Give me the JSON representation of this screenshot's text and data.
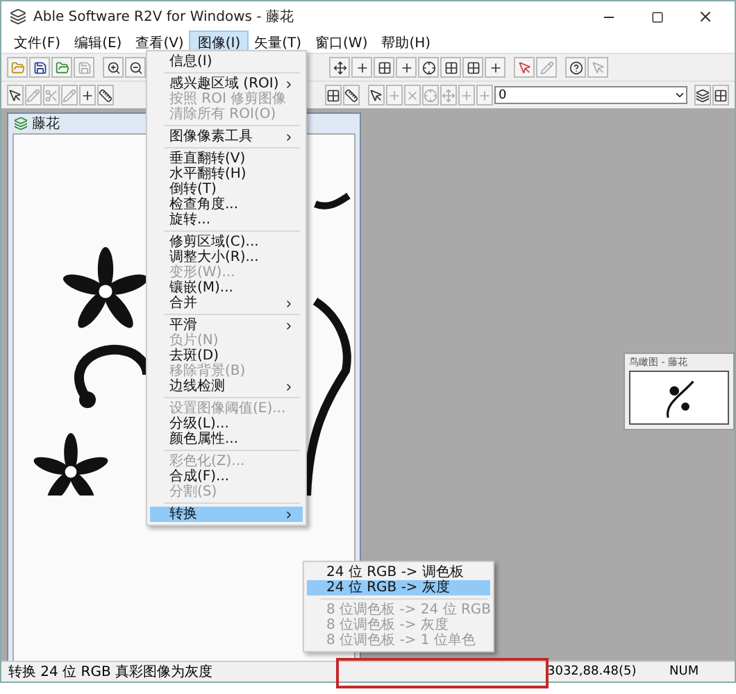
{
  "window": {
    "title": "Able Software R2V for Windows - 藤花"
  },
  "menubar": [
    {
      "label": "文件(F)",
      "selected": false
    },
    {
      "label": "编辑(E)",
      "selected": false
    },
    {
      "label": "查看(V)",
      "selected": false
    },
    {
      "label": "图像(I)",
      "selected": true
    },
    {
      "label": "矢量(T)",
      "selected": false
    },
    {
      "label": "窗口(W)",
      "selected": false
    },
    {
      "label": "帮助(H)",
      "selected": false
    }
  ],
  "toolbar": {
    "layer_field": {
      "value": "0"
    }
  },
  "image_window": {
    "title": "藤花"
  },
  "navigator": {
    "title": "鸟瞰图 - 藤花"
  },
  "menu": [
    {
      "kind": "item",
      "label": "信息(I)",
      "disabled": false,
      "submenu": false,
      "selected": false
    },
    {
      "kind": "separator"
    },
    {
      "kind": "item",
      "label": "感兴趣区域 (ROI)",
      "disabled": false,
      "submenu": true,
      "selected": false
    },
    {
      "kind": "item",
      "label": "按照 ROI 修剪图像",
      "disabled": true,
      "submenu": false,
      "selected": false
    },
    {
      "kind": "item",
      "label": "清除所有 ROI(O)",
      "disabled": true,
      "submenu": false,
      "selected": false
    },
    {
      "kind": "separator"
    },
    {
      "kind": "item",
      "label": "图像像素工具",
      "disabled": false,
      "submenu": true,
      "selected": false
    },
    {
      "kind": "separator"
    },
    {
      "kind": "item",
      "label": "垂直翻转(V)",
      "disabled": false,
      "submenu": false,
      "selected": false
    },
    {
      "kind": "item",
      "label": "水平翻转(H)",
      "disabled": false,
      "submenu": false,
      "selected": false
    },
    {
      "kind": "item",
      "label": "倒转(T)",
      "disabled": false,
      "submenu": false,
      "selected": false
    },
    {
      "kind": "item",
      "label": "检查角度...",
      "disabled": false,
      "submenu": false,
      "selected": false
    },
    {
      "kind": "item",
      "label": "旋转...",
      "disabled": false,
      "submenu": false,
      "selected": false
    },
    {
      "kind": "separator"
    },
    {
      "kind": "item",
      "label": "修剪区域(C)...",
      "disabled": false,
      "submenu": false,
      "selected": false
    },
    {
      "kind": "item",
      "label": "调整大小(R)...",
      "disabled": false,
      "submenu": false,
      "selected": false
    },
    {
      "kind": "item",
      "label": "变形(W)...",
      "disabled": true,
      "submenu": false,
      "selected": false
    },
    {
      "kind": "item",
      "label": "镶嵌(M)...",
      "disabled": false,
      "submenu": false,
      "selected": false
    },
    {
      "kind": "item",
      "label": "合并",
      "disabled": false,
      "submenu": true,
      "selected": false
    },
    {
      "kind": "separator"
    },
    {
      "kind": "item",
      "label": "平滑",
      "disabled": false,
      "submenu": true,
      "selected": false
    },
    {
      "kind": "item",
      "label": "负片(N)",
      "disabled": true,
      "submenu": false,
      "selected": false
    },
    {
      "kind": "item",
      "label": "去斑(D)",
      "disabled": false,
      "submenu": false,
      "selected": false
    },
    {
      "kind": "item",
      "label": "移除背景(B)",
      "disabled": true,
      "submenu": false,
      "selected": false
    },
    {
      "kind": "item",
      "label": "边线检测",
      "disabled": false,
      "submenu": true,
      "selected": false
    },
    {
      "kind": "separator"
    },
    {
      "kind": "item",
      "label": "设置图像阈值(E)...",
      "disabled": true,
      "submenu": false,
      "selected": false
    },
    {
      "kind": "item",
      "label": "分级(L)...",
      "disabled": false,
      "submenu": false,
      "selected": false
    },
    {
      "kind": "item",
      "label": "颜色属性...",
      "disabled": false,
      "submenu": false,
      "selected": false
    },
    {
      "kind": "separator"
    },
    {
      "kind": "item",
      "label": "彩色化(Z)...",
      "disabled": true,
      "submenu": false,
      "selected": false
    },
    {
      "kind": "item",
      "label": "合成(F)...",
      "disabled": false,
      "submenu": false,
      "selected": false
    },
    {
      "kind": "item",
      "label": "分割(S)",
      "disabled": true,
      "submenu": false,
      "selected": false
    },
    {
      "kind": "separator"
    },
    {
      "kind": "item",
      "label": "转换",
      "disabled": false,
      "submenu": true,
      "selected": true
    }
  ],
  "submenu": [
    {
      "kind": "item",
      "label": "24 位 RGB -> 调色板",
      "disabled": false,
      "submenu": false,
      "selected": false
    },
    {
      "kind": "item",
      "label": "24 位 RGB -> 灰度",
      "disabled": false,
      "submenu": false,
      "selected": true
    },
    {
      "kind": "separator"
    },
    {
      "kind": "item",
      "label": "8 位调色板 -> 24 位 RGB",
      "disabled": true,
      "submenu": false,
      "selected": false
    },
    {
      "kind": "item",
      "label": "8 位调色板 -> 灰度",
      "disabled": true,
      "submenu": false,
      "selected": false
    },
    {
      "kind": "item",
      "label": "8 位调色板 -> 1 位单色",
      "disabled": true,
      "submenu": false,
      "selected": false
    }
  ],
  "status_bar": {
    "message": "转换 24 位 RGB 真彩图像为灰度",
    "coordinates": "3032,88.48(5)",
    "indicator": "NUM"
  }
}
